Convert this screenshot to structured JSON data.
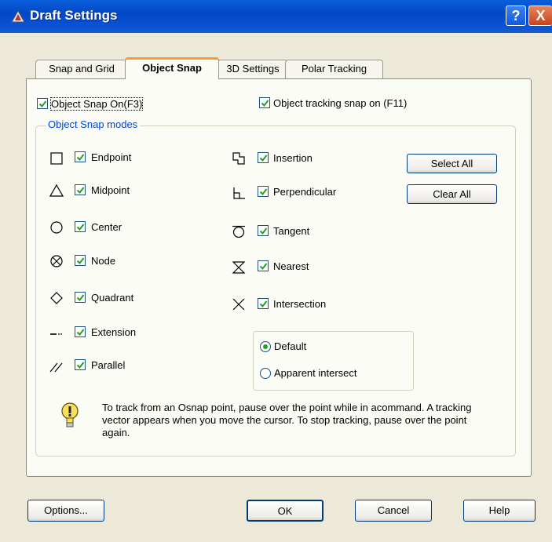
{
  "window": {
    "title": "Draft Settings",
    "help_glyph": "?",
    "close_glyph": "X"
  },
  "tabs": [
    {
      "label": "Snap and Grid",
      "active": false
    },
    {
      "label": "Object Snap",
      "active": true
    },
    {
      "label": "3D Settings",
      "active": false
    },
    {
      "label": "Polar Tracking",
      "active": false
    }
  ],
  "object_snap_on": {
    "label": "Object Snap On(F3)",
    "checked": true
  },
  "tracking_on": {
    "label": "Object tracking snap on (F11)",
    "checked": true
  },
  "modes_group": {
    "title": "Object Snap modes"
  },
  "modes_left": [
    {
      "label": "Endpoint",
      "icon": "square-icon",
      "checked": true
    },
    {
      "label": "Midpoint",
      "icon": "triangle-icon",
      "checked": true
    },
    {
      "label": "Center",
      "icon": "circle-icon",
      "checked": true
    },
    {
      "label": "Node",
      "icon": "node-icon",
      "checked": true
    },
    {
      "label": "Quadrant",
      "icon": "diamond-icon",
      "checked": true
    },
    {
      "label": "Extension",
      "icon": "extension-icon",
      "checked": true
    },
    {
      "label": "Parallel",
      "icon": "parallel-icon",
      "checked": true
    }
  ],
  "modes_right": [
    {
      "label": "Insertion",
      "icon": "insertion-icon",
      "checked": true
    },
    {
      "label": "Perpendicular",
      "icon": "perpendicular-icon",
      "checked": true
    },
    {
      "label": "Tangent",
      "icon": "tangent-icon",
      "checked": true
    },
    {
      "label": "Nearest",
      "icon": "nearest-icon",
      "checked": true
    },
    {
      "label": "Intersection",
      "icon": "intersection-icon",
      "checked": true
    }
  ],
  "buttons": {
    "select_all": "Select All",
    "clear_all": "Clear All"
  },
  "intersection_options": [
    {
      "label": "Default",
      "selected": true
    },
    {
      "label": "Apparent intersect",
      "selected": false
    }
  ],
  "info": {
    "text": "To track from an Osnap point, pause over the point while in acommand. A tracking vector appears when you move the cursor. To stop tracking, pause over the point again."
  },
  "footer": {
    "options": "Options...",
    "ok": "OK",
    "cancel": "Cancel",
    "help": "Help"
  },
  "colors": {
    "title_bar": "#0348c4",
    "accent_tab": "#f4a030",
    "group_title": "#0046d5",
    "check": "#21a121"
  }
}
